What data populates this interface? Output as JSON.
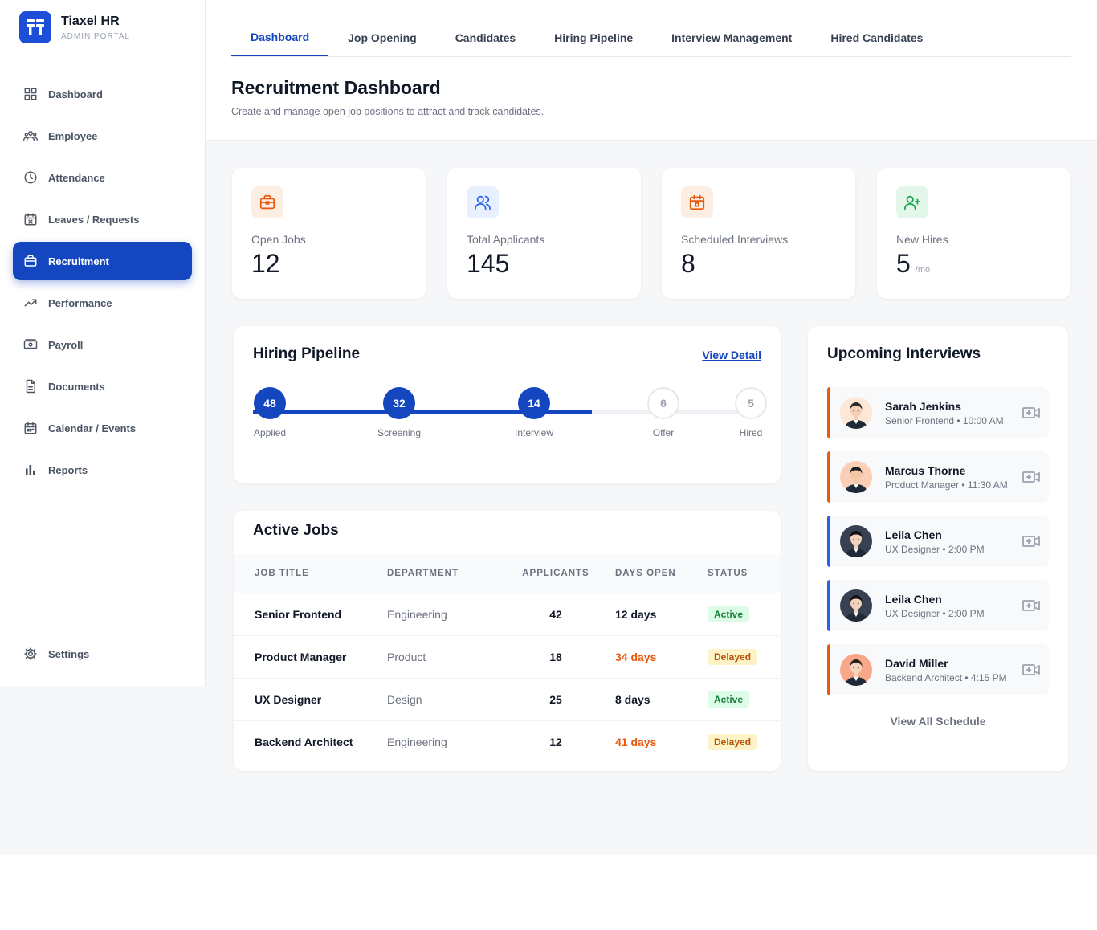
{
  "brand": {
    "name": "Tiaxel HR",
    "subtitle": "ADMIN PORTAL"
  },
  "sidebar": {
    "items": [
      {
        "label": "Dashboard",
        "icon": "grid-icon"
      },
      {
        "label": "Employee",
        "icon": "users-icon"
      },
      {
        "label": "Attendance",
        "icon": "clock-icon"
      },
      {
        "label": "Leaves / Requests",
        "icon": "calendar-x-icon"
      },
      {
        "label": "Recruitment",
        "icon": "briefcase-icon",
        "active": true
      },
      {
        "label": "Performance",
        "icon": "trending-up-icon"
      },
      {
        "label": "Payroll",
        "icon": "cash-icon"
      },
      {
        "label": "Documents",
        "icon": "document-icon"
      },
      {
        "label": "Calendar / Events",
        "icon": "calendar-icon"
      },
      {
        "label": "Reports",
        "icon": "bar-chart-icon"
      }
    ],
    "settings_label": "Settings"
  },
  "tabs": [
    "Dashboard",
    "Jop Opening",
    "Candidates",
    "Hiring Pipeline",
    "Interview Management",
    "Hired Candidates"
  ],
  "header": {
    "title": "Recruitment Dashboard",
    "subtitle": "Create and manage open job positions to attract and track candidates."
  },
  "stats": [
    {
      "label": "Open Jobs",
      "value": "12",
      "suffix": "",
      "icon": "briefcase-icon",
      "color": "#ea580c"
    },
    {
      "label": "Total Applicants",
      "value": "145",
      "suffix": "",
      "icon": "users-icon",
      "color": "#2563eb"
    },
    {
      "label": "Scheduled Interviews",
      "value": "8",
      "suffix": "",
      "icon": "calendar-icon",
      "color": "#ea580c"
    },
    {
      "label": "New Hires",
      "value": "5",
      "suffix": "/mo",
      "icon": "user-plus-icon",
      "color": "#16a34a"
    }
  ],
  "pipeline": {
    "title": "Hiring Pipeline",
    "link": "View Detail",
    "stages": [
      {
        "label": "Applied",
        "count": "48",
        "done": true
      },
      {
        "label": "Screening",
        "count": "32",
        "done": true
      },
      {
        "label": "Interview",
        "count": "14",
        "done": true
      },
      {
        "label": "Offer",
        "count": "6",
        "done": false
      },
      {
        "label": "Hired",
        "count": "5",
        "done": false
      }
    ]
  },
  "jobs": {
    "title": "Active Jobs",
    "columns": [
      "JOB TITLE",
      "DEPARTMENT",
      "APPLICANTS",
      "DAYS OPEN",
      "STATUS"
    ],
    "rows": [
      {
        "title": "Senior Frontend",
        "department": "Engineering",
        "applicants": "42",
        "days": "12 days",
        "status": "Active"
      },
      {
        "title": "Product Manager",
        "department": "Product",
        "applicants": "18",
        "days": "34 days",
        "status": "Delayed"
      },
      {
        "title": "UX Designer",
        "department": "Design",
        "applicants": "25",
        "days": "8 days",
        "status": "Active"
      },
      {
        "title": "Backend Architect",
        "department": "Engineering",
        "applicants": "12",
        "days": "41 days",
        "status": "Delayed"
      }
    ]
  },
  "interviews": {
    "title": "Upcoming Interviews",
    "items": [
      {
        "name": "Sarah Jenkins",
        "meta": "Senior Frontend • 10:00 AM",
        "accent": "#ea580c",
        "avatar_bg": "#fde7d6",
        "skin": "#f5d0b5",
        "hair": "#2b2b2b"
      },
      {
        "name": "Marcus Thorne",
        "meta": "Product Manager • 11:30 AM",
        "accent": "#ea580c",
        "avatar_bg": "#fbcfb6",
        "skin": "#f3c7a6",
        "hair": "#1f1f1f"
      },
      {
        "name": "Leila Chen",
        "meta": "UX Designer • 2:00 PM",
        "accent": "#2563eb",
        "avatar_bg": "#374151",
        "skin": "#f1d2bb",
        "hair": "#111111"
      },
      {
        "name": "Leila Chen",
        "meta": "UX Designer • 2:00 PM",
        "accent": "#2563eb",
        "avatar_bg": "#374151",
        "skin": "#f1d2bb",
        "hair": "#111111"
      },
      {
        "name": "David Miller",
        "meta": "Backend Architect • 4:15 PM",
        "accent": "#ea580c",
        "avatar_bg": "#f8a889",
        "skin": "#f6d4bd",
        "hair": "#2b2020"
      }
    ],
    "view_all": "View All Schedule"
  }
}
